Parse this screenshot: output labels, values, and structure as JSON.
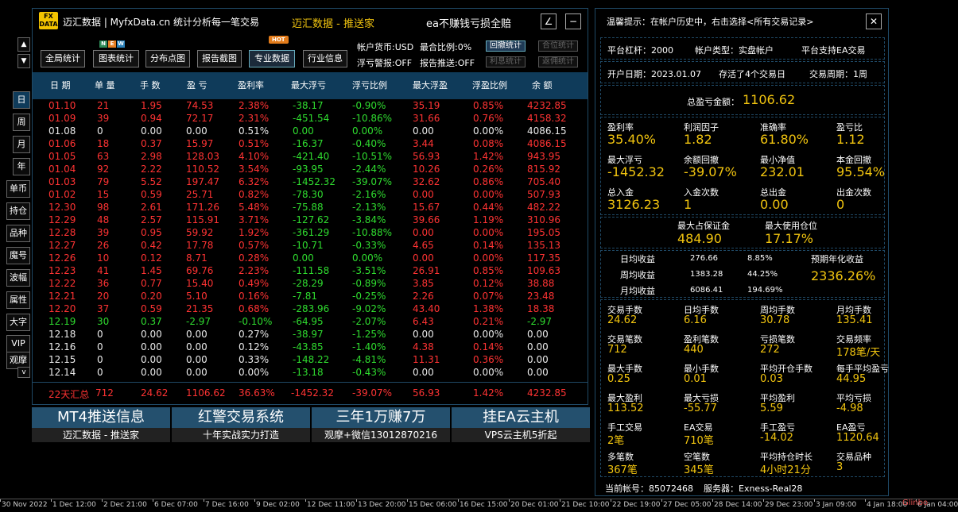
{
  "window": {
    "logo_top": "FX",
    "logo_bottom": "DATA",
    "title": "迈汇数据 | MyfxData.cn  统计分析每一笔交易",
    "center_title": "迈汇数据 - 推送家",
    "slogan": "ea不赚钱亏损全赔",
    "minimize_label": "∠",
    "close_label": "−"
  },
  "toolbar": {
    "buttons": [
      "全局统计",
      "图表统计",
      "分布点图",
      "报告截图",
      "专业数据",
      "行业信息"
    ],
    "new_badge": [
      "N",
      "E",
      "W"
    ],
    "hot_badge": "HOT",
    "account_currency": "帐户货币:USD",
    "max_ratio": "最合比例:0%",
    "float_warning": "浮亏警报:OFF",
    "report_push": "报告推送:OFF",
    "mini_buttons": [
      "回撤统计",
      "合位统计",
      "利息统计",
      "返佣统计"
    ]
  },
  "nav": [
    "日",
    "周",
    "月",
    "年",
    "单币",
    "持仓",
    "品种",
    "魔号",
    "波幅",
    "属性",
    "大字",
    "VIP",
    "观摩"
  ],
  "nav_up": "▲",
  "nav_down": "▼",
  "nav_more": "v",
  "table": {
    "headers": [
      "日 期",
      "单 量",
      "手 数",
      "盈 亏",
      "盈利率",
      "最大浮亏",
      "浮亏比例",
      "最大浮盈",
      "浮盈比例",
      "余 额"
    ],
    "rows": [
      {
        "c": "red",
        "v": [
          "01.10",
          "21",
          "1.95",
          "74.53",
          "2.38%",
          "-38.17",
          "-0.90%",
          "35.19",
          "0.85%",
          "4232.85"
        ]
      },
      {
        "c": "red",
        "v": [
          "01.09",
          "39",
          "0.94",
          "72.17",
          "2.31%",
          "-451.54",
          "-10.86%",
          "31.66",
          "0.76%",
          "4158.32"
        ]
      },
      {
        "c": "white",
        "v": [
          "01.08",
          "0",
          "0.00",
          "0.00",
          "0.51%",
          "0.00",
          "0.00%",
          "0.00",
          "0.00%",
          "4086.15"
        ]
      },
      {
        "c": "red",
        "v": [
          "01.06",
          "18",
          "0.37",
          "15.97",
          "0.51%",
          "-16.37",
          "-0.40%",
          "3.44",
          "0.08%",
          "4086.15"
        ]
      },
      {
        "c": "red",
        "v": [
          "01.05",
          "63",
          "2.98",
          "128.03",
          "4.10%",
          "-421.40",
          "-10.51%",
          "56.93",
          "1.42%",
          "943.95"
        ]
      },
      {
        "c": "red",
        "v": [
          "01.04",
          "92",
          "2.22",
          "110.52",
          "3.54%",
          "-93.95",
          "-2.44%",
          "10.26",
          "0.26%",
          "815.92"
        ]
      },
      {
        "c": "red",
        "v": [
          "01.03",
          "79",
          "5.52",
          "197.47",
          "6.32%",
          "-1452.32",
          "-39.07%",
          "32.62",
          "0.86%",
          "705.40"
        ]
      },
      {
        "c": "red",
        "v": [
          "01.02",
          "15",
          "0.59",
          "25.71",
          "0.82%",
          "-78.30",
          "-2.16%",
          "0.00",
          "0.00%",
          "507.93"
        ]
      },
      {
        "c": "red",
        "v": [
          "12.30",
          "98",
          "2.61",
          "171.26",
          "5.48%",
          "-75.88",
          "-2.13%",
          "15.67",
          "0.44%",
          "482.22"
        ]
      },
      {
        "c": "red",
        "v": [
          "12.29",
          "48",
          "2.57",
          "115.91",
          "3.71%",
          "-127.62",
          "-3.84%",
          "39.66",
          "1.19%",
          "310.96"
        ]
      },
      {
        "c": "red",
        "v": [
          "12.28",
          "39",
          "0.95",
          "59.92",
          "1.92%",
          "-361.29",
          "-10.88%",
          "0.00",
          "0.00%",
          "195.05"
        ]
      },
      {
        "c": "red",
        "v": [
          "12.27",
          "26",
          "0.42",
          "17.78",
          "0.57%",
          "-10.71",
          "-0.33%",
          "4.65",
          "0.14%",
          "135.13"
        ]
      },
      {
        "c": "red",
        "v": [
          "12.26",
          "10",
          "0.12",
          "8.71",
          "0.28%",
          "0.00",
          "0.00%",
          "0.00",
          "0.00%",
          "117.35"
        ]
      },
      {
        "c": "red",
        "v": [
          "12.23",
          "41",
          "1.45",
          "69.76",
          "2.23%",
          "-111.58",
          "-3.51%",
          "26.91",
          "0.85%",
          "109.63"
        ]
      },
      {
        "c": "red",
        "v": [
          "12.22",
          "36",
          "0.77",
          "15.40",
          "0.49%",
          "-28.29",
          "-0.89%",
          "3.85",
          "0.12%",
          "38.88"
        ]
      },
      {
        "c": "red",
        "v": [
          "12.21",
          "20",
          "0.20",
          "5.10",
          "0.16%",
          "-7.81",
          "-0.25%",
          "2.26",
          "0.07%",
          "23.48"
        ]
      },
      {
        "c": "red",
        "v": [
          "12.20",
          "37",
          "0.59",
          "21.35",
          "0.68%",
          "-283.96",
          "-9.02%",
          "43.40",
          "1.38%",
          "18.38"
        ]
      },
      {
        "c": "green",
        "v": [
          "12.19",
          "30",
          "0.37",
          "-2.97",
          "-0.10%",
          "-64.95",
          "-2.07%",
          "6.43",
          "0.21%",
          "-2.97"
        ]
      },
      {
        "c": "white",
        "v": [
          "12.18",
          "0",
          "0.00",
          "0.00",
          "0.27%",
          "-38.97",
          "-1.25%",
          "0.00",
          "0.00%",
          "0.00"
        ]
      },
      {
        "c": "white",
        "v": [
          "12.16",
          "0",
          "0.00",
          "0.00",
          "0.12%",
          "-43.85",
          "-1.40%",
          "4.38",
          "0.14%",
          "0.00"
        ]
      },
      {
        "c": "white",
        "v": [
          "12.15",
          "0",
          "0.00",
          "0.00",
          "0.33%",
          "-148.22",
          "-4.81%",
          "11.31",
          "0.36%",
          "0.00"
        ]
      },
      {
        "c": "white",
        "v": [
          "12.14",
          "0",
          "0.00",
          "0.00",
          "0.00%",
          "-13.18",
          "-0.43%",
          "0.00",
          "0.00%",
          "0.00"
        ]
      }
    ],
    "summary": [
      "22天汇总",
      "712",
      "24.62",
      "1106.62",
      "36.63%",
      "-1452.32",
      "-39.07%",
      "56.93",
      "1.42%",
      "4232.85"
    ]
  },
  "banners": [
    {
      "top": "MT4推送信息",
      "bottom": "迈汇数据 - 推送家"
    },
    {
      "top": "红警交易系统",
      "bottom": "十年实战实力打造"
    },
    {
      "top": "三年1万赚7万",
      "bottom": "观摩+微信13012870216"
    },
    {
      "top": "挂EA云主机",
      "bottom": "VPS云主机5折起"
    }
  ],
  "right": {
    "tip": "温馨提示：在帐户历史中，右击选择<所有交易记录>",
    "close_label": "✕",
    "leverage": "平台杠杆：2000",
    "account_type": "帐户类型：实盘帐户",
    "ea_support": "平台支持EA交易",
    "open_date": "开户日期：2023.01.07",
    "days_alive": "存活了4个交易日",
    "trade_cycle": "交易周期：1周",
    "total_pl_label": "总盈亏金额：",
    "total_pl": "1106.62",
    "stats1": [
      {
        "k": "盈利率",
        "v": "35.40%"
      },
      {
        "k": "利润因子",
        "v": "1.82"
      },
      {
        "k": "准确率",
        "v": "61.80%"
      },
      {
        "k": "盈亏比",
        "v": "1.12"
      },
      {
        "k": "最大浮亏",
        "v": "-1452.32"
      },
      {
        "k": "余额回撤",
        "v": "-39.07%"
      },
      {
        "k": "最小净值",
        "v": "232.01"
      },
      {
        "k": "本金回撤",
        "v": "95.54%"
      },
      {
        "k": "总入金",
        "v": "3126.23"
      },
      {
        "k": "入金次数",
        "v": "1"
      },
      {
        "k": "总出金",
        "v": "0.00"
      },
      {
        "k": "出金次数",
        "v": "0"
      }
    ],
    "margin": [
      {
        "k": "最大占保证金",
        "v": "484.90"
      },
      {
        "k": "最大使用仓位",
        "v": "17.17%"
      }
    ],
    "income": [
      {
        "k": "日均收益",
        "a": "276.66",
        "b": "8.85%"
      },
      {
        "k": "周均收益",
        "a": "1383.28",
        "b": "44.25%"
      },
      {
        "k": "月均收益",
        "a": "6086.41",
        "b": "194.69%"
      }
    ],
    "annual_label": "预期年化收益",
    "annual_value": "2336.26%",
    "stats2": [
      {
        "k": "交易手数",
        "v": "24.62"
      },
      {
        "k": "日均手数",
        "v": "6.16"
      },
      {
        "k": "周均手数",
        "v": "30.78"
      },
      {
        "k": "月均手数",
        "v": "135.41"
      },
      {
        "k": "交易笔数",
        "v": "712"
      },
      {
        "k": "盈利笔数",
        "v": "440"
      },
      {
        "k": "亏损笔数",
        "v": "272"
      },
      {
        "k": "交易频率",
        "v": "178笔/天"
      },
      {
        "k": "最大手数",
        "v": "0.25"
      },
      {
        "k": "最小手数",
        "v": "0.01"
      },
      {
        "k": "平均开仓手数",
        "v": "0.03"
      },
      {
        "k": "每手平均盈亏",
        "v": "44.95"
      },
      {
        "k": "最大盈利",
        "v": "113.52"
      },
      {
        "k": "最大亏损",
        "v": "-55.77"
      },
      {
        "k": "平均盈利",
        "v": "5.59"
      },
      {
        "k": "平均亏损",
        "v": "-4.98"
      },
      {
        "k": "手工交易",
        "v": "2笔"
      },
      {
        "k": "EA交易",
        "v": "710笔"
      },
      {
        "k": "手工盈亏",
        "v": "-14.02"
      },
      {
        "k": "EA盈亏",
        "v": "1120.64"
      },
      {
        "k": "多笔数",
        "v": "367笔"
      },
      {
        "k": "空笔数",
        "v": "345笔"
      },
      {
        "k": "平均持仓时长",
        "v": "4小时21分"
      },
      {
        "k": "交易品种",
        "v": "3"
      }
    ],
    "account_no": "当前帐号：85072468",
    "server": "服务器：Exness-Real28"
  },
  "axis": [
    "30 Nov 2022",
    "1 Dec 12:00",
    "2 Dec 21:00",
    "6 Dec 07:00",
    "7 Dec 16:00",
    "9 Dec 02:00",
    "12 Dec 11:00",
    "13 Dec 20:00",
    "15 Dec 06:00",
    "16 Dec 15:00",
    "20 Dec 01:00",
    "21 Dec 10:00",
    "22 Dec 19:00",
    "27 Dec 05:00",
    "28 Dec 14:00",
    "29 Dec 23:00",
    "3 Jan 09:00",
    "4 Jan 18:00",
    "6 Jan 04:00"
  ],
  "watermark": "Glinbo"
}
